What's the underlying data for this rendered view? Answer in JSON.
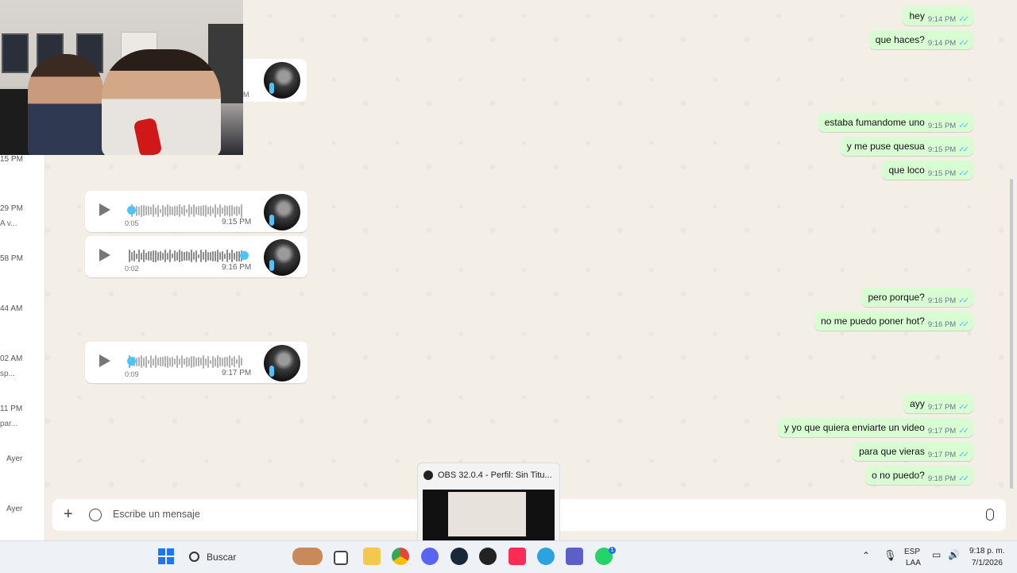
{
  "sidebar": {
    "times": [
      "15 PM",
      "29 PM",
      "58 PM",
      "44 AM",
      "02 AM",
      "11 PM",
      "Ayer",
      "Ayer"
    ],
    "snippets": [
      "A v...",
      "sp...",
      "par..."
    ]
  },
  "voice_notes": [
    {
      "duration": "0:05",
      "time": "9:15 PM",
      "progress": 0.0
    },
    {
      "duration": "0:02",
      "time": "9:16 PM",
      "progress": 1.0
    },
    {
      "duration": "0:09",
      "time": "9:17 PM",
      "progress": 0.0
    }
  ],
  "fragment_time": "M",
  "messages": [
    {
      "text": "hey",
      "time": "9:14 PM"
    },
    {
      "text": "que haces?",
      "time": "9:14 PM"
    },
    {
      "text": "estaba fumandome uno",
      "time": "9:15 PM"
    },
    {
      "text": "y me puse quesua",
      "time": "9:15 PM"
    },
    {
      "text": "que loco",
      "time": "9:15 PM"
    },
    {
      "text": "pero porque?",
      "time": "9:16 PM"
    },
    {
      "text": "no me puedo poner hot?",
      "time": "9:16 PM"
    },
    {
      "text": "ayy",
      "time": "9:17 PM"
    },
    {
      "text": "y yo que quiera enviarte un video",
      "time": "9:17 PM"
    },
    {
      "text": "para que vieras",
      "time": "9:17 PM"
    },
    {
      "text": "o no puedo?",
      "time": "9:18 PM"
    }
  ],
  "composer": {
    "placeholder": "Escribe un mensaje"
  },
  "obs_preview": {
    "title": "OBS 32.0.4 - Perfil: Sin Titu..."
  },
  "taskbar": {
    "search_label": "Buscar",
    "language_top": "ESP",
    "language_bottom": "LAA",
    "clock_time": "9:18 p. m.",
    "clock_date": "7/1/2026",
    "whatsapp_badge": "1"
  },
  "colors": {
    "outgoing_bubble": "#d9fdd3",
    "tick": "#53bdeb",
    "voice_dot": "#4fc3f7",
    "chat_bg": "#f3eee6"
  }
}
